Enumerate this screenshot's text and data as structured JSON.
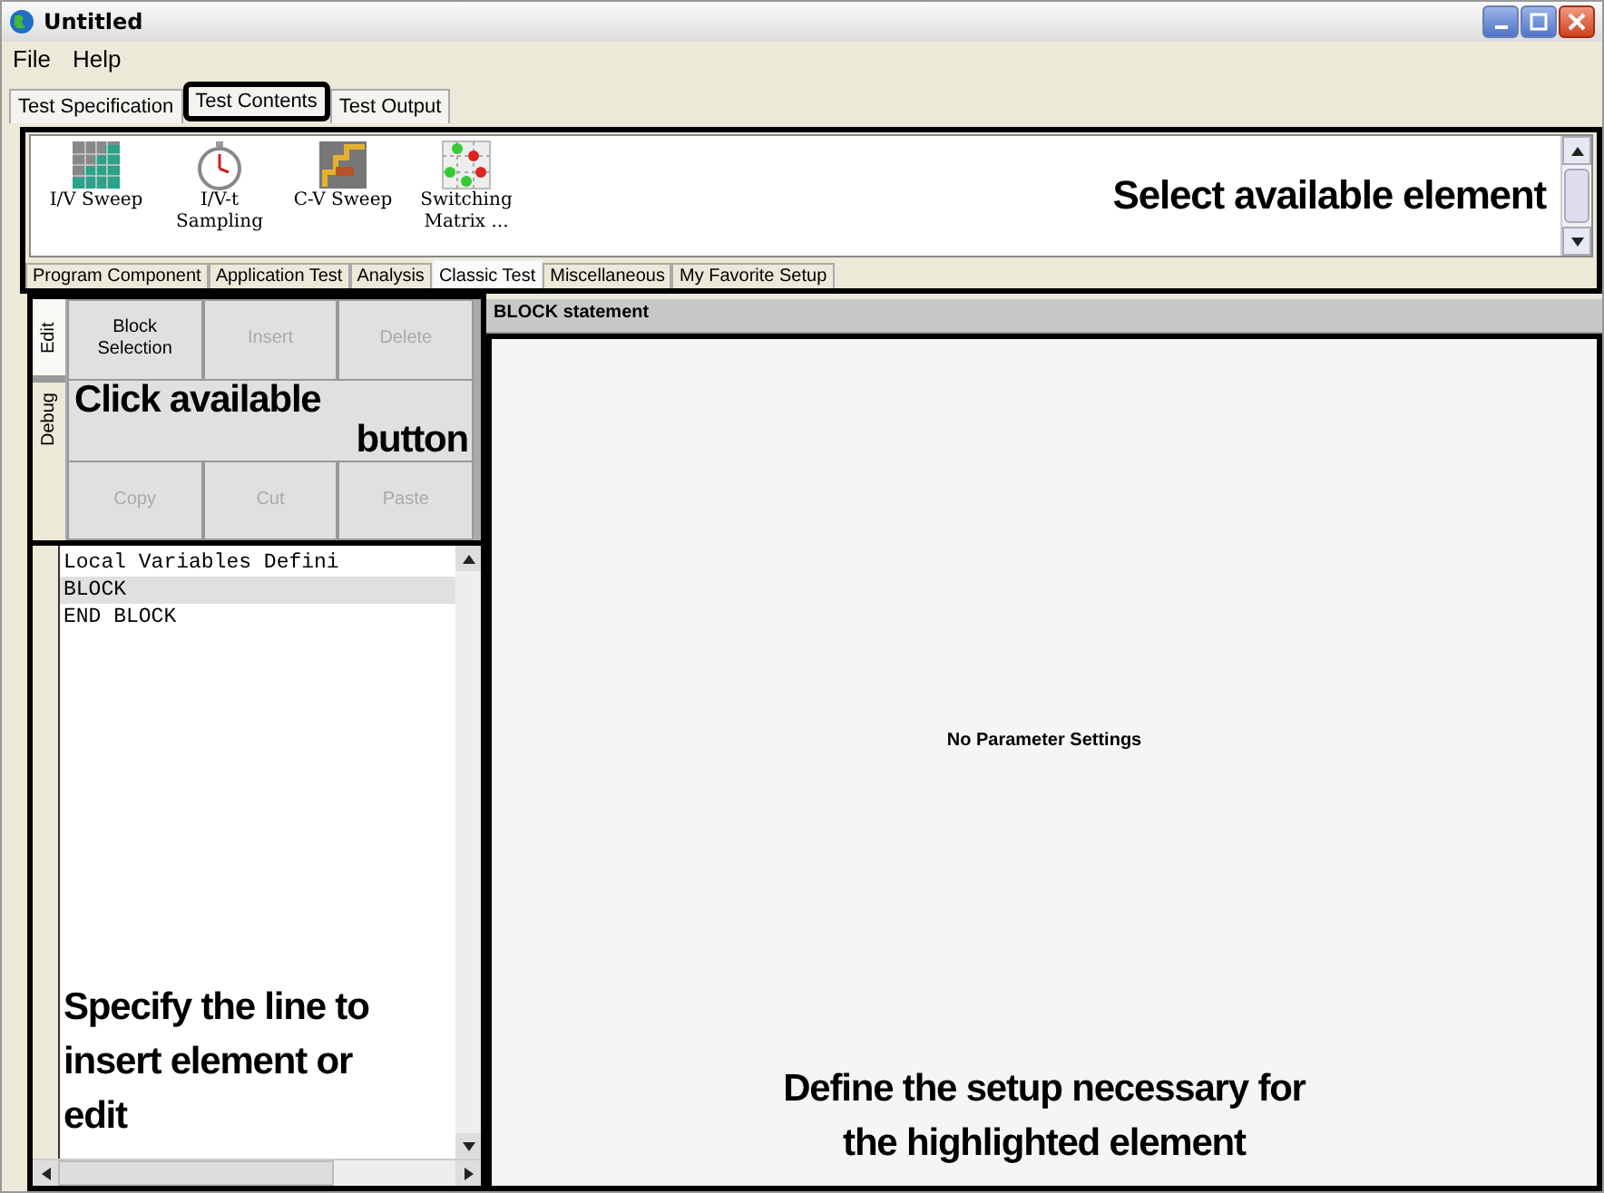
{
  "window": {
    "title": "Untitled"
  },
  "menu": [
    "File",
    "Help"
  ],
  "tabs": [
    {
      "label": "Test Specification",
      "selected": false
    },
    {
      "label": "Test Contents",
      "selected": true
    },
    {
      "label": "Test Output",
      "selected": false
    }
  ],
  "palette": {
    "items": [
      {
        "label": "I/V Sweep",
        "kind": "staircase"
      },
      {
        "label": "I/V-t Sampling",
        "kind": "stopwatch"
      },
      {
        "label": "C-V Sweep",
        "kind": "cv"
      },
      {
        "label": "Switching Matrix ...",
        "kind": "matrix"
      }
    ],
    "annotation": "Select available element",
    "categories": [
      {
        "label": "Program Component",
        "selected": false
      },
      {
        "label": "Application Test",
        "selected": false
      },
      {
        "label": "Analysis",
        "selected": false
      },
      {
        "label": "Classic Test",
        "selected": true
      },
      {
        "label": "Miscellaneous",
        "selected": false
      },
      {
        "label": "My Favorite Setup",
        "selected": false
      }
    ]
  },
  "side_tabs": [
    {
      "label": "Edit",
      "selected": true
    },
    {
      "label": "Debug",
      "selected": false
    }
  ],
  "buttons": [
    {
      "label": "Block Selection",
      "disabled": false
    },
    {
      "label": "Insert",
      "disabled": true
    },
    {
      "label": "Delete",
      "disabled": true
    },
    {
      "label": "Copy",
      "disabled": true
    },
    {
      "label": "Cut",
      "disabled": true
    },
    {
      "label": "Paste",
      "disabled": true
    }
  ],
  "buttons_annotation": [
    "Click available",
    "button"
  ],
  "program_lines": [
    {
      "text": "Local Variables Defini",
      "selected": false
    },
    {
      "text": "BLOCK",
      "selected": true
    },
    {
      "text": "END BLOCK",
      "selected": false
    }
  ],
  "lines_annotation": "Specify the line to insert element or edit",
  "setup": {
    "header": "BLOCK statement",
    "message": "No Parameter Settings",
    "annotation": "Define the setup necessary for the highlighted element"
  }
}
